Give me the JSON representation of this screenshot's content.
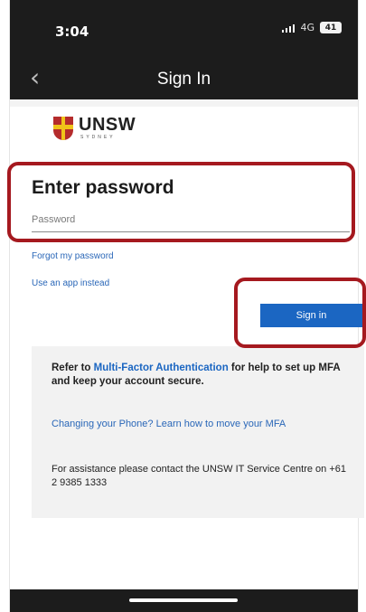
{
  "status_bar": {
    "time": "3:04",
    "network": "4G",
    "battery": "41"
  },
  "nav": {
    "back_icon": "chevron-left-icon",
    "title": "Sign In"
  },
  "logo": {
    "name": "UNSW",
    "subtitle": "SYDNEY"
  },
  "form": {
    "heading": "Enter password",
    "password_placeholder": "Password",
    "forgot_link": "Forgot my password",
    "app_link": "Use an app instead",
    "signin_label": "Sign in"
  },
  "info": {
    "refer_prefix": "Refer to ",
    "refer_link": "Multi-Factor Authentication",
    "refer_suffix": " for help to set up MFA and keep your account secure.",
    "phone_link": "Changing your Phone? Learn how to move your MFA",
    "assistance": "For assistance please contact the UNSW IT Service Centre on +61 2 9385 1333"
  },
  "colors": {
    "accent": "#1b66c2",
    "highlight": "#a5191f",
    "nav_background": "#1c1c1c"
  }
}
